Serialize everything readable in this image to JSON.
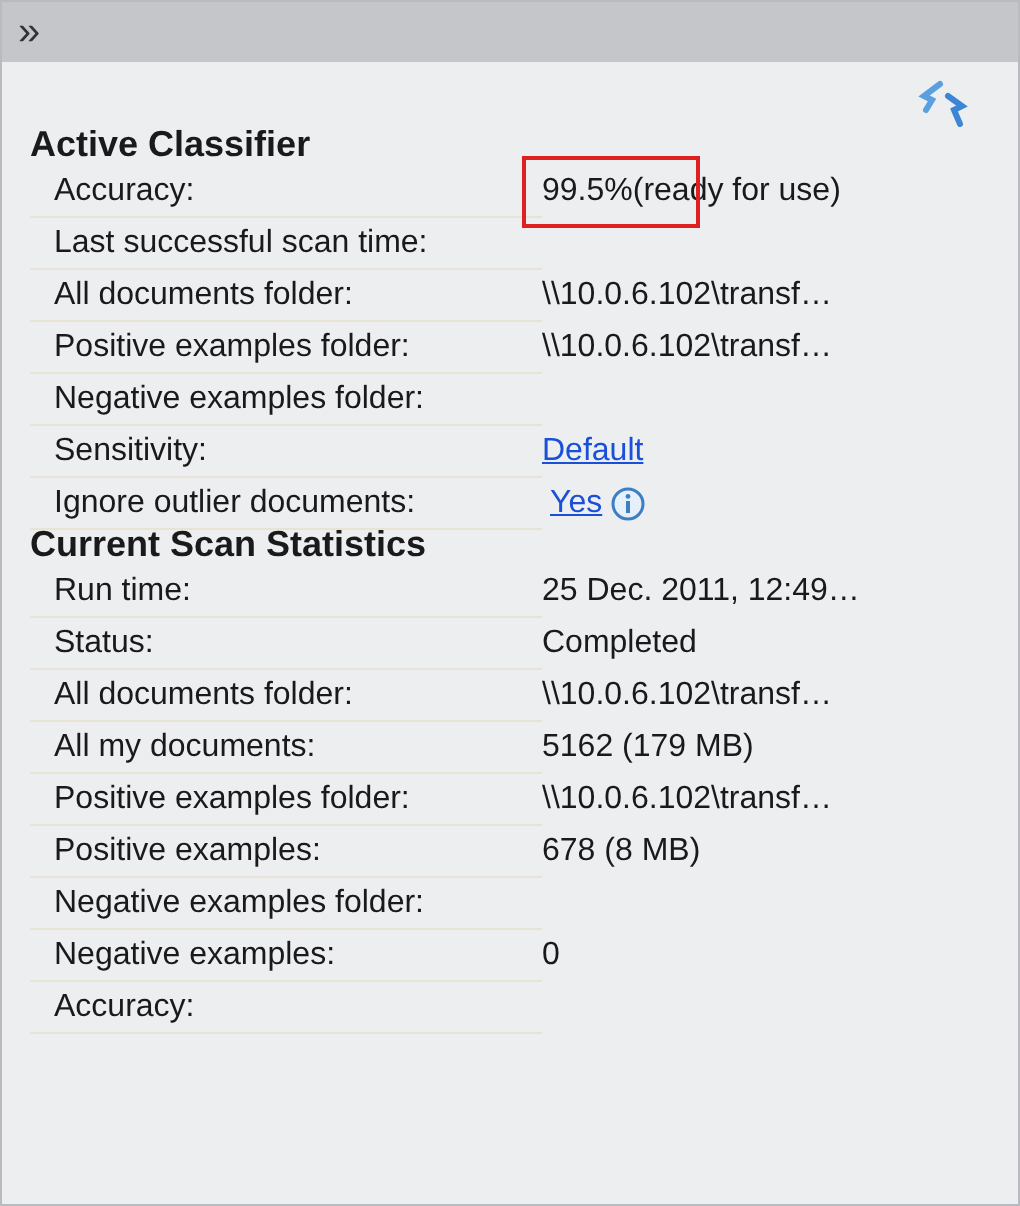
{
  "toolbar": {
    "expand": "»"
  },
  "sections": [
    {
      "title": "Active Classifier",
      "rows": [
        {
          "label": "Accuracy:",
          "value": "99.5%(ready for use)",
          "kind": "text",
          "highlighted": true
        },
        {
          "label": "Last successful scan time:"
        },
        {
          "label": "All documents folder:",
          "value": "\\\\10.0.6.102\\transf…",
          "kind": "text"
        },
        {
          "label": "Positive examples folder:",
          "value": "\\\\10.0.6.102\\transf…",
          "kind": "text"
        },
        {
          "label": "Negative examples folder:"
        },
        {
          "label": "Sensitivity:",
          "value": "Default",
          "kind": "link"
        },
        {
          "label": "Ignore outlier documents:",
          "value": "Yes",
          "kind": "link_info"
        }
      ]
    },
    {
      "title": "Current Scan Statistics",
      "rows": [
        {
          "label": "Run time:",
          "value": "25 Dec. 2011, 12:49…",
          "kind": "text"
        },
        {
          "label": "Status:",
          "value": "Completed",
          "kind": "text"
        },
        {
          "label": "All documents folder:",
          "value": "\\\\10.0.6.102\\transf…",
          "kind": "text"
        },
        {
          "label": "All my documents:",
          "value": "5162 (179 MB)",
          "kind": "text"
        },
        {
          "label": "Positive examples folder:",
          "value": "\\\\10.0.6.102\\transf…",
          "kind": "text"
        },
        {
          "label": "Positive examples:",
          "value": "678 (8 MB)",
          "kind": "text"
        },
        {
          "label": "Negative examples folder:"
        },
        {
          "label": "Negative examples:",
          "value": "0",
          "kind": "text"
        },
        {
          "label": "Accuracy:"
        }
      ]
    }
  ]
}
